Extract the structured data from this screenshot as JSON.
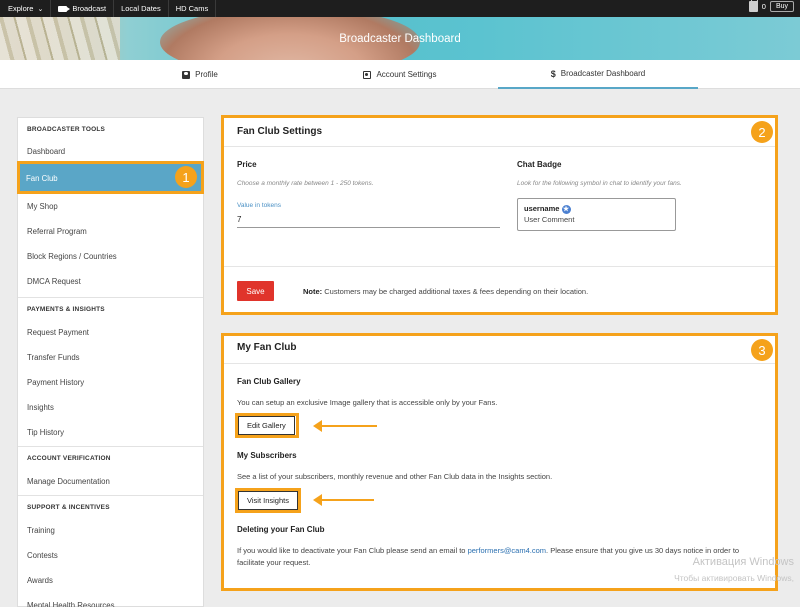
{
  "topnav": {
    "explore": "Explore",
    "broadcast": "Broadcast",
    "local_dates": "Local Dates",
    "hd_cams": "HD Cams",
    "tokens": "0",
    "buy": "Buy"
  },
  "banner": {
    "title": "Broadcaster Dashboard"
  },
  "tabs": [
    {
      "label": "Profile",
      "icon": "profile-icon"
    },
    {
      "label": "Account Settings",
      "icon": "settings-icon"
    },
    {
      "label": "Broadcaster Dashboard",
      "icon": "dollar-icon"
    }
  ],
  "sidebar": {
    "sections": [
      {
        "title": "BROADCASTER TOOLS",
        "items": [
          "Dashboard",
          "Fan Club",
          "My Shop",
          "Referral Program",
          "Block Regions / Countries",
          "DMCA Request"
        ]
      },
      {
        "title": "PAYMENTS & INSIGHTS",
        "items": [
          "Request Payment",
          "Transfer Funds",
          "Payment History",
          "Insights",
          "Tip History"
        ]
      },
      {
        "title": "ACCOUNT VERIFICATION",
        "items": [
          "Manage Documentation"
        ]
      },
      {
        "title": "SUPPORT & INCENTIVES",
        "items": [
          "Training",
          "Contests",
          "Awards",
          "Mental Health Resources"
        ]
      }
    ],
    "active_item": "Fan Club"
  },
  "callouts": {
    "one": "1",
    "two": "2",
    "three": "3",
    "color": "#f5a21b"
  },
  "fan_club_settings": {
    "title": "Fan Club Settings",
    "price_label": "Price",
    "price_hint": "Choose a monthly rate between 1 - 250 tokens.",
    "value_label": "Value in tokens",
    "value": "7",
    "badge_label": "Chat Badge",
    "badge_hint": "Look for the following symbol in chat to identify your fans.",
    "badge_username": "username",
    "badge_comment": "User Comment",
    "save": "Save",
    "note_bold": "Note:",
    "note_text": "Customers may be charged additional taxes & fees depending on their location."
  },
  "my_fan_club": {
    "title": "My Fan Club",
    "gallery_title": "Fan Club Gallery",
    "gallery_text": "You can setup an exclusive Image gallery that is accessible only by your Fans.",
    "edit_gallery": "Edit Gallery",
    "subscribers_title": "My Subscribers",
    "subscribers_text": "See a list of your subscribers, monthly revenue and other Fan Club data in the Insights section.",
    "visit_insights": "Visit Insights",
    "delete_title": "Deleting your Fan Club",
    "delete_text_1": "If you would like to deactivate your Fan Club please send an email to",
    "delete_email": "performers@cam4.com",
    "delete_text_2": ". Please ensure that you give us 30 days notice in order",
    "delete_text_3": "to facilitate your request."
  },
  "watermark": {
    "line1": "Активация Windows",
    "line2": "Чтобы активировать Windows,"
  }
}
